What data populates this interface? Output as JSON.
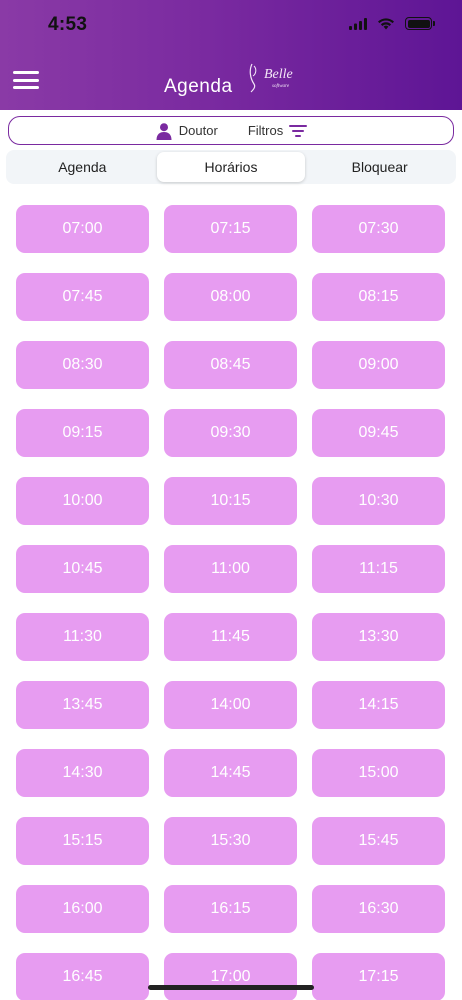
{
  "status_bar": {
    "time": "4:53"
  },
  "header": {
    "title": "Agenda",
    "menu_icon": "hamburger-icon",
    "logo_alt": "Belle logo"
  },
  "filters": {
    "doctor_label": "Doutor",
    "filters_label": "Filtros"
  },
  "tabs": [
    {
      "label": "Agenda",
      "active": false
    },
    {
      "label": "Horários",
      "active": true
    },
    {
      "label": "Bloquear",
      "active": false
    }
  ],
  "slots": [
    "07:00",
    "07:15",
    "07:30",
    "07:45",
    "08:00",
    "08:15",
    "08:30",
    "08:45",
    "09:00",
    "09:15",
    "09:30",
    "09:45",
    "10:00",
    "10:15",
    "10:30",
    "10:45",
    "11:00",
    "11:15",
    "11:30",
    "11:45",
    "13:30",
    "13:45",
    "14:00",
    "14:15",
    "14:30",
    "14:45",
    "15:00",
    "15:15",
    "15:30",
    "15:45",
    "16:00",
    "16:15",
    "16:30",
    "16:45",
    "17:00",
    "17:15"
  ],
  "colors": {
    "header_start": "#8a3aa6",
    "header_end": "#5e1595",
    "slot_bg": "#e79cf1",
    "accent": "#7a2aa0"
  }
}
